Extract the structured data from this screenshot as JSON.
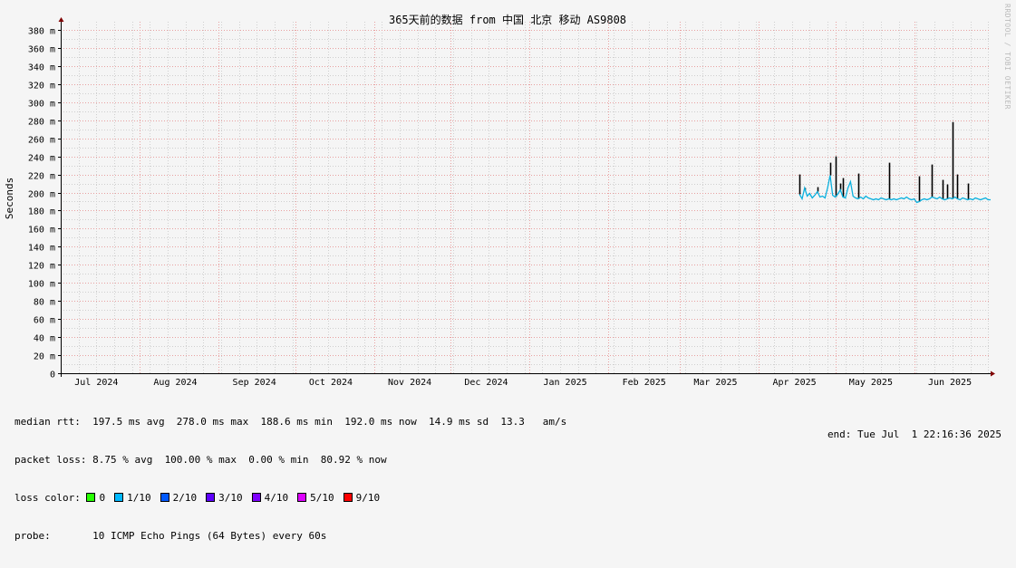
{
  "chart_data": {
    "type": "line",
    "title": "365天前的数据 from 中国 北京 移动 AS9808",
    "ylabel": "Seconds",
    "xlabel": "",
    "ylim": [
      0,
      0.38
    ],
    "yticks": [
      {
        "v": 0,
        "label": "0"
      },
      {
        "v": 0.02,
        "label": "20 m"
      },
      {
        "v": 0.04,
        "label": "40 m"
      },
      {
        "v": 0.06,
        "label": "60 m"
      },
      {
        "v": 0.08,
        "label": "80 m"
      },
      {
        "v": 0.1,
        "label": "100 m"
      },
      {
        "v": 0.12,
        "label": "120 m"
      },
      {
        "v": 0.14,
        "label": "140 m"
      },
      {
        "v": 0.16,
        "label": "160 m"
      },
      {
        "v": 0.18,
        "label": "180 m"
      },
      {
        "v": 0.2,
        "label": "200 m"
      },
      {
        "v": 0.22,
        "label": "220 m"
      },
      {
        "v": 0.24,
        "label": "240 m"
      },
      {
        "v": 0.26,
        "label": "260 m"
      },
      {
        "v": 0.28,
        "label": "280 m"
      },
      {
        "v": 0.3,
        "label": "300 m"
      },
      {
        "v": 0.32,
        "label": "320 m"
      },
      {
        "v": 0.34,
        "label": "340 m"
      },
      {
        "v": 0.36,
        "label": "360 m"
      },
      {
        "v": 0.38,
        "label": "380 m"
      }
    ],
    "xlim": [
      "2024-07-01",
      "2025-07-01"
    ],
    "month_starts": [
      "2024-07-01",
      "2024-08-01",
      "2024-09-01",
      "2024-10-01",
      "2024-11-01",
      "2024-12-01",
      "2025-01-01",
      "2025-02-01",
      "2025-03-01",
      "2025-04-01",
      "2025-05-01",
      "2025-06-01"
    ],
    "xtick_labels": [
      {
        "date": "2024-07-15",
        "label": "Jul 2024"
      },
      {
        "date": "2024-08-15",
        "label": "Aug 2024"
      },
      {
        "date": "2024-09-15",
        "label": "Sep 2024"
      },
      {
        "date": "2024-10-15",
        "label": "Oct 2024"
      },
      {
        "date": "2024-11-15",
        "label": "Nov 2024"
      },
      {
        "date": "2024-12-15",
        "label": "Dec 2024"
      },
      {
        "date": "2025-01-15",
        "label": "Jan 2025"
      },
      {
        "date": "2025-02-15",
        "label": "Feb 2025"
      },
      {
        "date": "2025-03-15",
        "label": "Mar 2025"
      },
      {
        "date": "2025-04-15",
        "label": "Apr 2025"
      },
      {
        "date": "2025-05-15",
        "label": "May 2025"
      },
      {
        "date": "2025-06-15",
        "label": "Jun 2025"
      }
    ],
    "grid": true,
    "series": [
      {
        "kind": "median",
        "x": [
          "2025-04-17",
          "2025-04-18",
          "2025-04-19",
          "2025-04-20",
          "2025-04-21",
          "2025-04-22",
          "2025-04-23",
          "2025-04-24",
          "2025-04-25",
          "2025-04-26",
          "2025-04-27",
          "2025-04-28",
          "2025-04-29",
          "2025-04-30",
          "2025-05-01",
          "2025-05-02",
          "2025-05-03",
          "2025-05-04",
          "2025-05-05",
          "2025-05-06",
          "2025-05-07",
          "2025-05-08",
          "2025-05-09",
          "2025-05-10",
          "2025-05-11",
          "2025-05-12",
          "2025-05-13",
          "2025-05-14",
          "2025-05-15",
          "2025-05-16",
          "2025-05-17",
          "2025-05-18",
          "2025-05-19",
          "2025-05-20",
          "2025-05-21",
          "2025-05-22",
          "2025-05-23",
          "2025-05-24",
          "2025-05-25",
          "2025-05-26",
          "2025-05-27",
          "2025-05-28",
          "2025-05-29",
          "2025-05-30",
          "2025-05-31",
          "2025-06-01",
          "2025-06-02",
          "2025-06-03",
          "2025-06-04",
          "2025-06-05",
          "2025-06-06",
          "2025-06-07",
          "2025-06-08",
          "2025-06-09",
          "2025-06-10",
          "2025-06-11",
          "2025-06-12",
          "2025-06-13",
          "2025-06-14",
          "2025-06-15",
          "2025-06-16",
          "2025-06-17",
          "2025-06-18",
          "2025-06-19",
          "2025-06-20",
          "2025-06-21",
          "2025-06-22",
          "2025-06-23",
          "2025-06-24",
          "2025-06-25",
          "2025-06-26",
          "2025-06-27",
          "2025-06-28",
          "2025-06-29",
          "2025-06-30",
          "2025-07-01"
        ],
        "y": [
          0.198,
          0.193,
          0.205,
          0.196,
          0.199,
          0.194,
          0.197,
          0.201,
          0.195,
          0.196,
          0.194,
          0.205,
          0.219,
          0.197,
          0.195,
          0.198,
          0.203,
          0.195,
          0.194,
          0.205,
          0.212,
          0.196,
          0.194,
          0.193,
          0.195,
          0.193,
          0.196,
          0.194,
          0.193,
          0.192,
          0.193,
          0.192,
          0.194,
          0.193,
          0.192,
          0.193,
          0.192,
          0.193,
          0.192,
          0.193,
          0.194,
          0.193,
          0.195,
          0.193,
          0.192,
          0.193,
          0.189,
          0.19,
          0.192,
          0.193,
          0.192,
          0.193,
          0.195,
          0.194,
          0.193,
          0.195,
          0.193,
          0.192,
          0.193,
          0.194,
          0.193,
          0.195,
          0.193,
          0.192,
          0.194,
          0.193,
          0.192,
          0.193,
          0.192,
          0.194,
          0.193,
          0.192,
          0.193,
          0.194,
          0.192,
          0.192
        ]
      },
      {
        "kind": "max",
        "x": [
          "2025-04-17",
          "2025-04-19",
          "2025-04-24",
          "2025-04-29",
          "2025-05-01",
          "2025-05-03",
          "2025-05-04",
          "2025-05-10",
          "2025-05-22",
          "2025-06-03",
          "2025-06-08",
          "2025-06-12",
          "2025-06-14",
          "2025-06-16",
          "2025-06-18",
          "2025-06-22"
        ],
        "y": [
          0.22,
          0.203,
          0.206,
          0.233,
          0.24,
          0.21,
          0.216,
          0.221,
          0.233,
          0.218,
          0.231,
          0.214,
          0.209,
          0.278,
          0.22,
          0.21
        ]
      }
    ]
  },
  "stats": {
    "rtt_line": "median rtt:  197.5 ms avg  278.0 ms max  188.6 ms min  192.0 ms now  14.9 ms sd  13.3   am/s",
    "loss_line": "packet loss: 8.75 % avg  100.00 % max  0.00 % min  80.92 % now",
    "loss_color_label": "loss color:",
    "loss_colors": [
      {
        "label": "0",
        "color": "#26ff00"
      },
      {
        "label": "1/10",
        "color": "#00b8ff"
      },
      {
        "label": "2/10",
        "color": "#0059ff"
      },
      {
        "label": "3/10",
        "color": "#5e00ff"
      },
      {
        "label": "4/10",
        "color": "#7e00ff"
      },
      {
        "label": "5/10",
        "color": "#dd00ff"
      },
      {
        "label": "9/10",
        "color": "#ff0000"
      }
    ],
    "probe_line": "probe:       10 ICMP Echo Pings (64 Bytes) every 60s",
    "end_line": "end: Tue Jul  1 22:16:36 2025"
  },
  "watermark": "RRDTOOL / TOBI OETIKER",
  "colors": {
    "median": "#0bb0de",
    "max": "#000000",
    "grid_major": "#e8a0a0",
    "grid_minor": "#cfcfcf",
    "axis": "#000000",
    "arrow": "#800000",
    "background": "#f5f5f5"
  }
}
